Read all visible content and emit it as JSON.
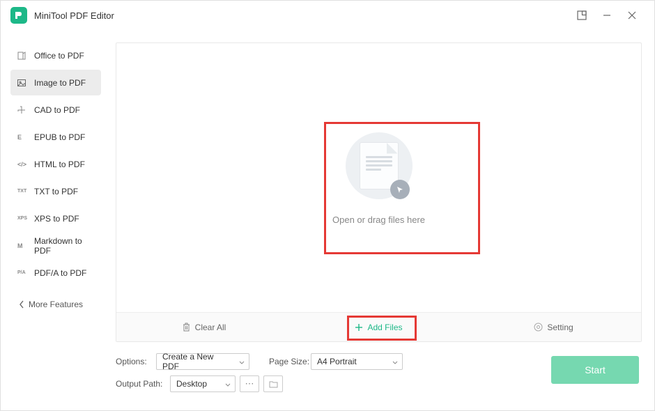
{
  "app": {
    "title": "MiniTool PDF Editor"
  },
  "sidebar": {
    "items": [
      {
        "label": "Office to PDF",
        "icon_txt": ""
      },
      {
        "label": "Image to PDF",
        "icon_txt": ""
      },
      {
        "label": "CAD to PDF",
        "icon_txt": ""
      },
      {
        "label": "EPUB to PDF",
        "icon_txt": "E"
      },
      {
        "label": "HTML to PDF",
        "icon_txt": "</>"
      },
      {
        "label": "TXT to PDF",
        "icon_txt": "TXT"
      },
      {
        "label": "XPS to PDF",
        "icon_txt": "XPS"
      },
      {
        "label": "Markdown to PDF",
        "icon_txt": "M"
      },
      {
        "label": "PDF/A to PDF",
        "icon_txt": "P/A"
      }
    ],
    "active_index": 1,
    "more_features": "More Features"
  },
  "drop": {
    "text": "Open or drag files here"
  },
  "actions": {
    "clear": "Clear All",
    "add": "Add Files",
    "setting": "Setting"
  },
  "options": {
    "options_label": "Options:",
    "options_value": "Create a New PDF",
    "page_size_label": "Page Size:",
    "page_size_value": "A4 Portrait",
    "output_path_label": "Output Path:",
    "output_path_value": "Desktop",
    "start": "Start"
  }
}
